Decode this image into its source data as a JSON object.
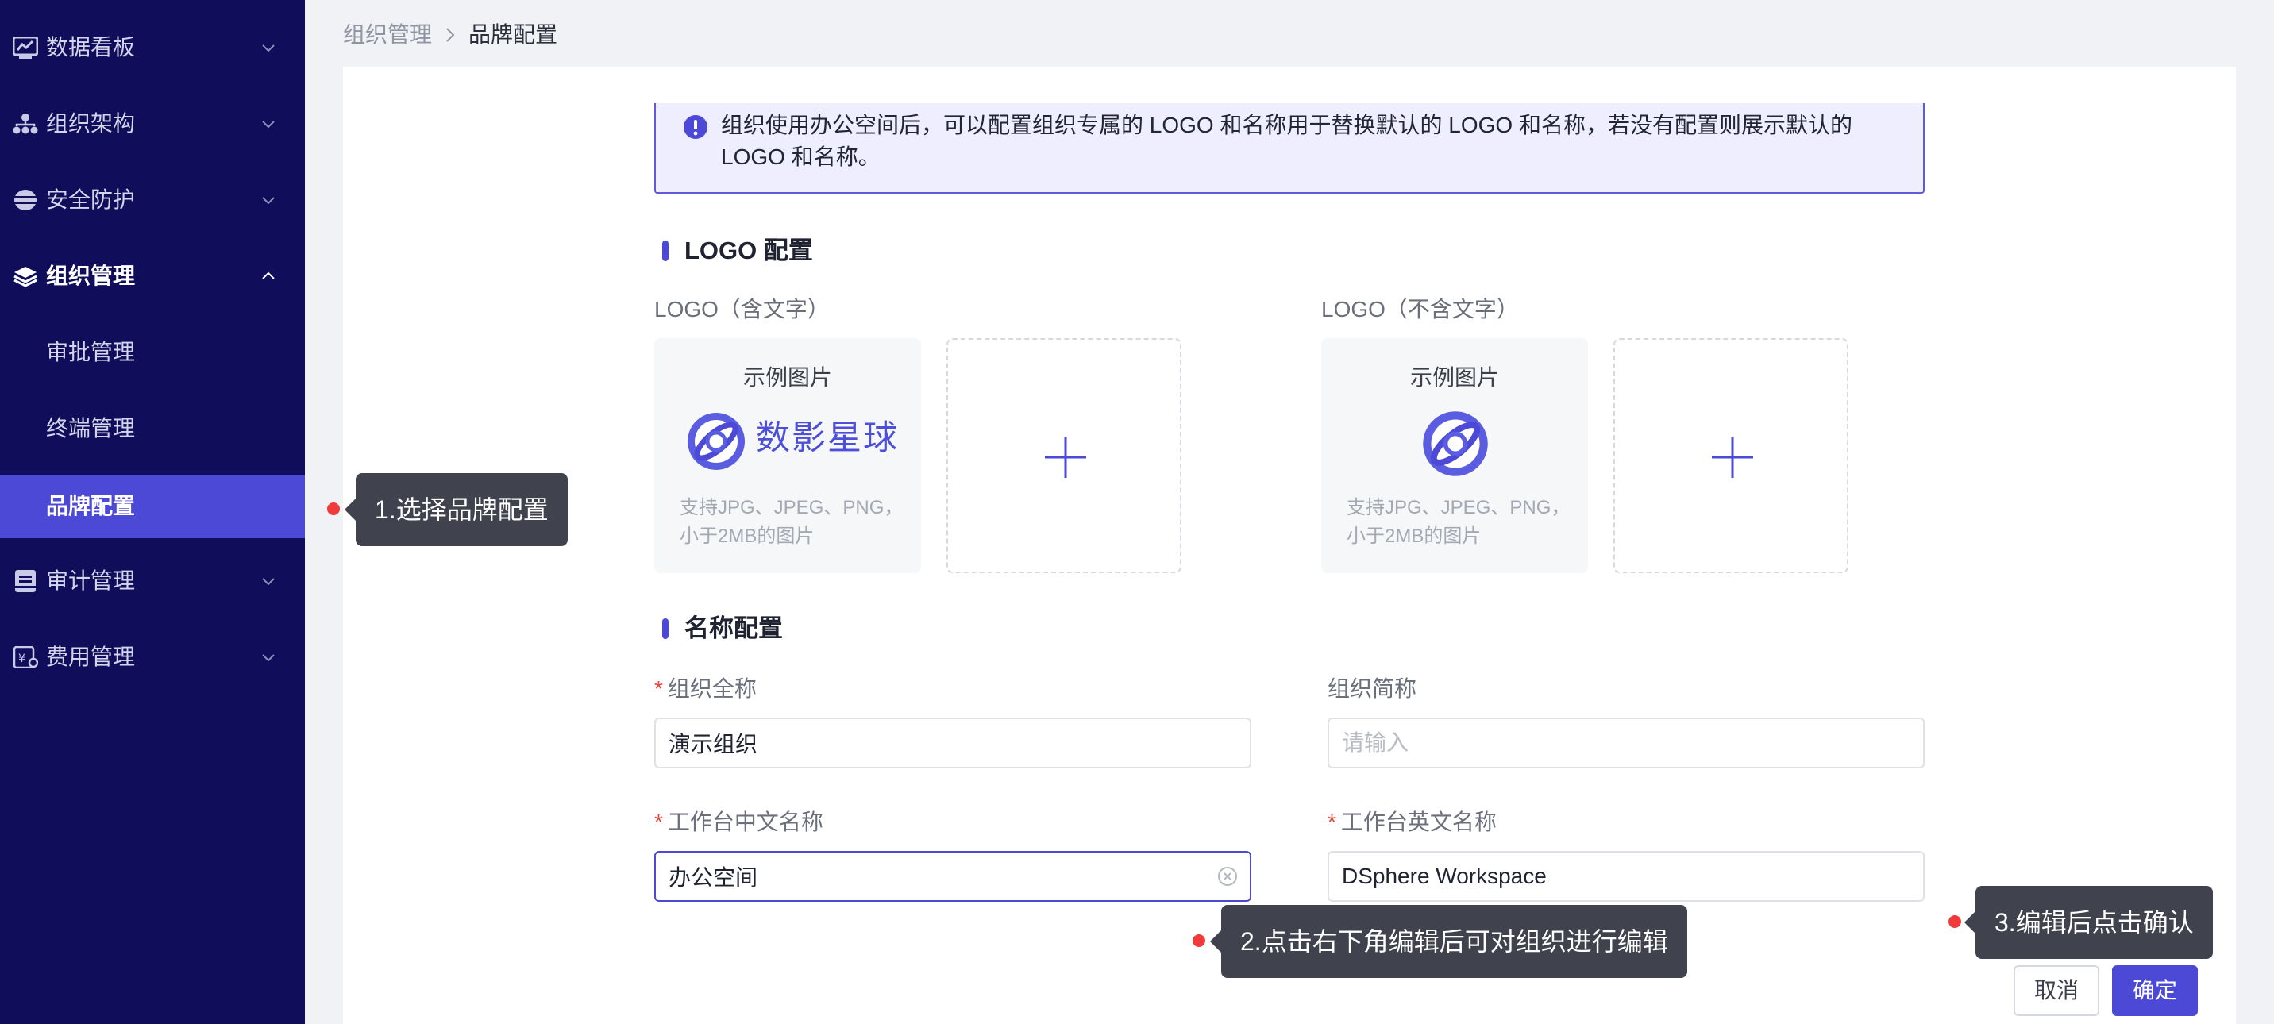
{
  "sidebar": {
    "items": [
      {
        "label": "数据看板",
        "icon": "dashboard-icon"
      },
      {
        "label": "组织架构",
        "icon": "org-tree-icon"
      },
      {
        "label": "安全防护",
        "icon": "shield-icon"
      },
      {
        "label": "组织管理",
        "icon": "layers-icon",
        "expanded": true
      },
      {
        "label": "审计管理",
        "icon": "audit-icon"
      },
      {
        "label": "费用管理",
        "icon": "billing-icon"
      }
    ],
    "sub_items": [
      {
        "label": "审批管理"
      },
      {
        "label": "终端管理"
      },
      {
        "label": "品牌配置",
        "selected": true
      }
    ]
  },
  "breadcrumb": {
    "parent": "组织管理",
    "current": "品牌配置"
  },
  "notice": {
    "text": "组织使用办公空间后，可以配置组织专属的 LOGO 和名称用于替换默认的 LOGO 和名称，若没有配置则展示默认的 LOGO 和名称。"
  },
  "logo_section": {
    "title": "LOGO 配置",
    "with_text": {
      "label": "LOGO（含文字）",
      "sample_title": "示例图片",
      "brand_text": "数影星球",
      "hint": "支持JPG、JPEG、PNG，小于2MB的图片"
    },
    "without_text": {
      "label": "LOGO（不含文字）",
      "sample_title": "示例图片",
      "hint": "支持JPG、JPEG、PNG，小于2MB的图片"
    }
  },
  "name_section": {
    "title": "名称配置",
    "full_name": {
      "label": "组织全称",
      "required": "*",
      "value": "演示组织"
    },
    "short_name": {
      "label": "组织简称",
      "placeholder": "请输入"
    },
    "cn_name": {
      "label": "工作台中文名称",
      "required": "*",
      "value": "办公空间"
    },
    "en_name": {
      "label": "工作台英文名称",
      "required": "*",
      "value": "DSphere Workspace"
    }
  },
  "tooltips": {
    "step1": "1.选择品牌配置",
    "step2": "2.点击右下角编辑后可对组织进行编辑",
    "step3": "3.编辑后点击确认"
  },
  "actions": {
    "cancel": "取消",
    "confirm": "确定"
  },
  "colors": {
    "sidebar_bg": "#100e5a",
    "accent": "#4b49d6",
    "tooltip_bg": "#40424d",
    "marker_red": "#ef3b3b"
  }
}
